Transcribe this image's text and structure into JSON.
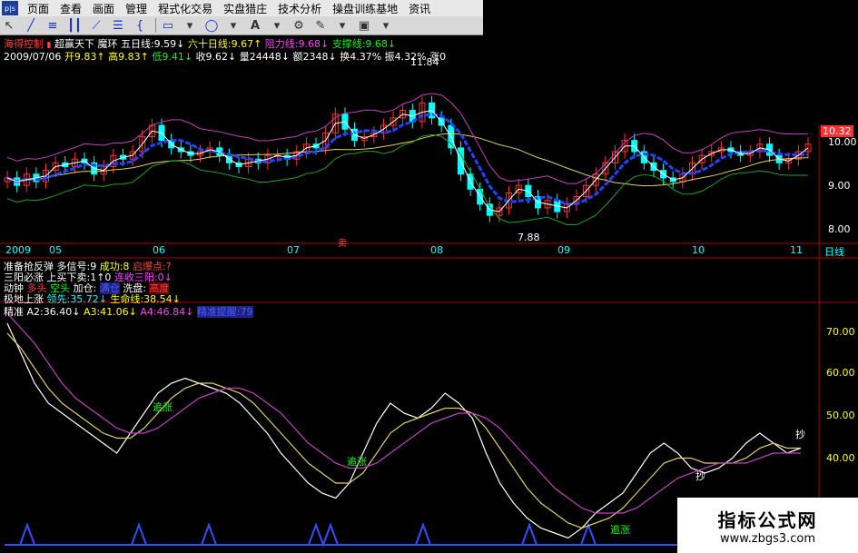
{
  "menu": {
    "logo": "p|s",
    "items": [
      "页面",
      "查看",
      "画面",
      "管理",
      "程式化交易",
      "实盘猎庄",
      "技术分析",
      "操盘训练基地",
      "资讯"
    ]
  },
  "toolbar": {
    "icons": [
      "cursor-icon",
      "line-icon",
      "parallel-line-icon",
      "vertical-lines-icon",
      "fan-icon",
      "fibonacci-icon",
      "brace-icon",
      "rectangle-icon",
      "ellipse-icon",
      "text-icon",
      "gear-icon",
      "eraser-icon",
      "dropdown-icon",
      "save-icon",
      "dropdown-icon"
    ]
  },
  "header": {
    "stock_name": "海得控制",
    "indicator_name": "超赢天下",
    "indicator_sub": "魔环",
    "ma5_label": "五日线:9.59↓",
    "ma60_label": "六十日线:9.67↑",
    "resist_label": "阻力线:9.68↓",
    "support_label": "支撑线:9.68↓"
  },
  "quote": {
    "date": "2009/07/06",
    "open": "开9.83↑",
    "high": "高9.83↑",
    "low": "低9.41↓",
    "close": "收9.62↓",
    "volume": "量24448↓",
    "amount": "额2348↓",
    "turnover": "换4.37%",
    "amplitude": "振4.32%",
    "change": "涨0"
  },
  "price_axis": {
    "ticks": [
      "10.00",
      "9.00",
      "8.00"
    ],
    "current": "10.32"
  },
  "annotations": {
    "high": "11.84",
    "low": "7.88",
    "sell_mark": "卖"
  },
  "time_axis": {
    "labels": [
      "2009",
      "05",
      "06",
      "07",
      "08",
      "09",
      "10",
      "11"
    ],
    "period": "日线"
  },
  "signals": {
    "row1": [
      "准备抢反弹",
      "多信号:9",
      "成功:8",
      "启爆点:?"
    ],
    "row2": [
      "三阳必涨",
      "上买下卖:1↑0",
      "连收三阳:0↓"
    ],
    "row3": [
      "动钟",
      "多头",
      "空头",
      "加仓:",
      "满仓",
      "洗盘:",
      "高度"
    ],
    "row4": [
      "极地上涨",
      "领先:35.72↓",
      "生命线:38.54↓"
    ],
    "row5": [
      "精准",
      "A2:36.40↓",
      "A3:41.06↓",
      "A4:46.84↓",
      "精准提醒:79"
    ]
  },
  "osc_axis": {
    "ticks": [
      "70.00",
      "60.00",
      "50.00",
      "40.00"
    ]
  },
  "osc_marks": {
    "up": "追涨",
    "buy": "抄"
  },
  "watermark": {
    "title": "指标公式网",
    "url": "www.zbgs3.com"
  },
  "colors": {
    "bg": "#000000",
    "up": "#ff3030",
    "down": "#00ffff",
    "ma_blue": "#2244ff",
    "band_magenta": "#c040c0",
    "band_green": "#20a020",
    "ma_yellow": "#e0d060"
  },
  "chart_data": [
    {
      "type": "candlestick",
      "title": "",
      "ylim": [
        7.6,
        12.2
      ],
      "yticks": [
        8.0,
        9.0,
        10.0
      ],
      "close_series": [
        9.2,
        9.0,
        9.3,
        9.1,
        9.4,
        9.6,
        9.5,
        9.7,
        9.6,
        9.3,
        9.5,
        9.8,
        9.7,
        9.9,
        10.3,
        10.6,
        10.2,
        10.0,
        9.9,
        9.8,
        9.9,
        10.0,
        9.8,
        9.6,
        9.5,
        9.7,
        9.6,
        9.8,
        9.8,
        9.7,
        9.9,
        10.1,
        10.0,
        10.4,
        10.9,
        10.5,
        10.2,
        10.3,
        10.4,
        10.6,
        10.8,
        11.0,
        10.7,
        11.2,
        10.8,
        10.6,
        10.0,
        9.3,
        8.9,
        8.5,
        8.2,
        8.4,
        8.8,
        9.0,
        8.7,
        8.4,
        8.6,
        8.3,
        8.5,
        8.7,
        9.0,
        9.3,
        9.6,
        9.9,
        10.2,
        9.9,
        9.6,
        9.4,
        9.2,
        9.1,
        9.3,
        9.6,
        9.8,
        9.9,
        10.0,
        9.9,
        9.8,
        9.9,
        10.1,
        9.8,
        9.6,
        9.7,
        9.9,
        10.1
      ]
    },
    {
      "type": "line",
      "title": "",
      "ylim": [
        30,
        76
      ],
      "yticks": [
        40,
        50,
        60,
        70
      ],
      "series": [
        {
          "values": [
            74,
            68,
            62,
            58,
            56,
            54,
            52,
            50,
            48,
            52,
            56,
            60,
            62,
            63,
            62,
            61,
            60,
            58,
            55,
            52,
            48,
            45,
            42,
            40,
            39,
            42,
            48,
            54,
            58,
            56,
            55,
            57,
            60,
            58,
            55,
            48,
            42,
            38,
            35,
            33,
            32,
            31,
            33,
            36,
            38,
            40,
            44,
            48,
            50,
            48,
            45,
            44,
            45,
            47,
            50,
            52,
            50,
            48,
            49
          ]
        },
        {
          "values": [
            72,
            69,
            65,
            61,
            58,
            56,
            54,
            52,
            51,
            51,
            53,
            56,
            59,
            61,
            62,
            62,
            61,
            60,
            58,
            55,
            52,
            49,
            46,
            44,
            42,
            42,
            44,
            48,
            52,
            54,
            55,
            56,
            57,
            57,
            56,
            53,
            49,
            45,
            41,
            38,
            36,
            34,
            33,
            34,
            35,
            37,
            40,
            43,
            46,
            47,
            47,
            46,
            46,
            46,
            47,
            49,
            50,
            49,
            49
          ]
        },
        {
          "values": [
            76,
            73,
            70,
            66,
            62,
            59,
            57,
            55,
            53,
            52,
            52,
            53,
            55,
            57,
            59,
            60,
            61,
            61,
            60,
            58,
            56,
            53,
            50,
            48,
            46,
            45,
            45,
            46,
            48,
            50,
            52,
            54,
            55,
            56,
            56,
            55,
            53,
            50,
            47,
            44,
            41,
            39,
            37,
            36,
            36,
            36,
            37,
            39,
            41,
            43,
            44,
            45,
            46,
            46,
            46,
            47,
            48,
            48,
            48
          ]
        }
      ]
    }
  ]
}
